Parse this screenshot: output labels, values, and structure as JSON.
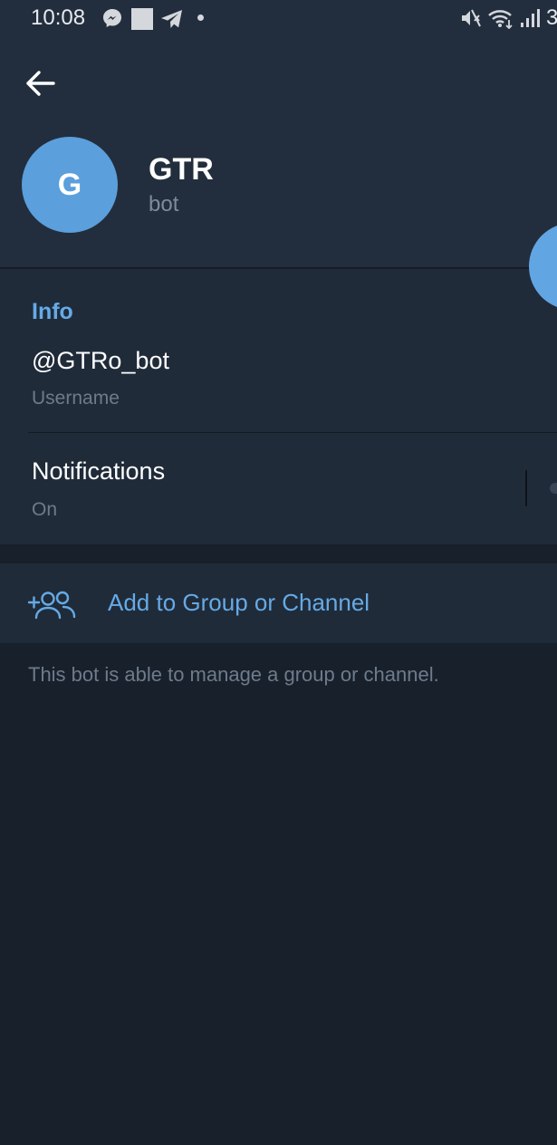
{
  "status_bar": {
    "time": "10:08",
    "battery_partial": "3"
  },
  "profile": {
    "avatar_letter": "G",
    "name": "GTR",
    "status": "bot"
  },
  "info": {
    "heading": "Info",
    "username": "@GTRo_bot",
    "username_label": "Username",
    "notifications_label": "Notifications",
    "notifications_value": "On"
  },
  "actions": {
    "add_to_group": "Add to Group or Channel"
  },
  "description": "This bot is able to manage a group or channel.",
  "colors": {
    "accent": "#65aae6",
    "avatar": "#5b9fdc",
    "background": "#18202b",
    "surface": "#202b39",
    "header": "#222e3d"
  },
  "icons": {
    "back": "arrow-left-icon",
    "add_group": "add-group-icon"
  }
}
